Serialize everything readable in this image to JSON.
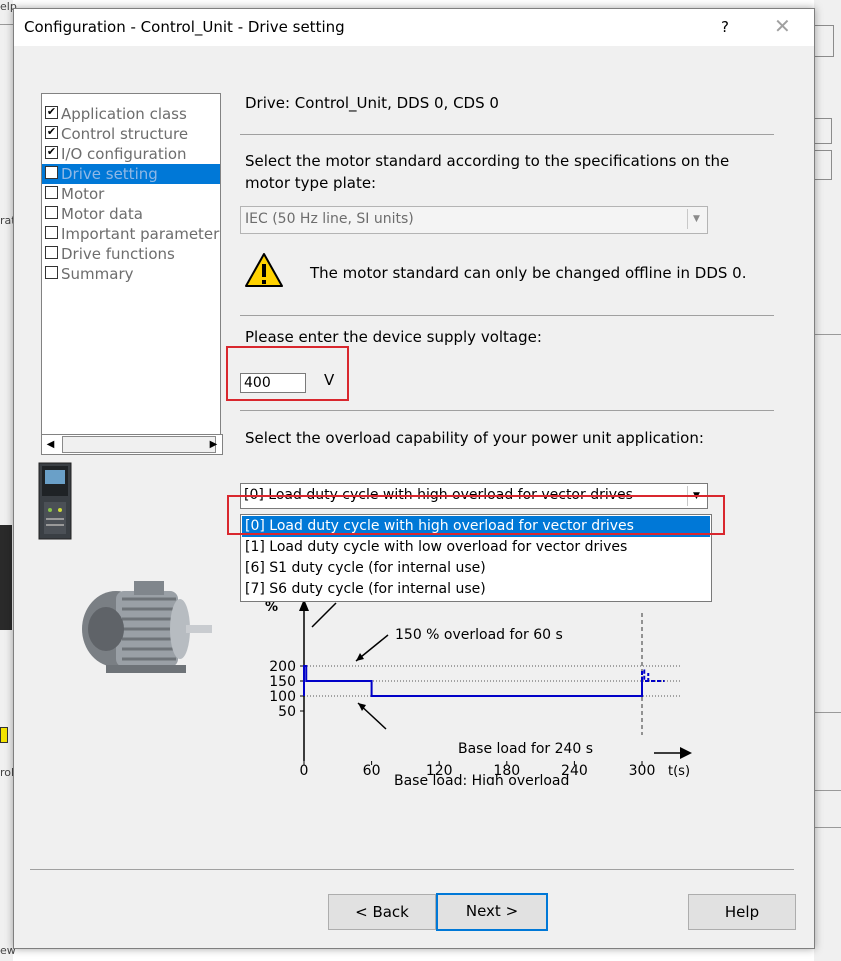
{
  "dialog": {
    "title": "Configuration - Control_Unit - Drive setting",
    "help_glyph": "?",
    "close_glyph": "✕"
  },
  "background": {
    "left_fragments": [
      "elp",
      "rat",
      "rol",
      "ew"
    ]
  },
  "nav": {
    "items": [
      {
        "label": "Application class",
        "checked": true
      },
      {
        "label": "Control structure",
        "checked": true
      },
      {
        "label": "I/O configuration",
        "checked": true
      },
      {
        "label": "Drive setting",
        "checked": false,
        "active": true
      },
      {
        "label": "Motor",
        "checked": false
      },
      {
        "label": "Motor data",
        "checked": false
      },
      {
        "label": "Important parameters",
        "checked": false
      },
      {
        "label": "Drive functions",
        "checked": false
      },
      {
        "label": "Summary",
        "checked": false
      }
    ],
    "check_glyph": "✔",
    "scroll_left": "◀",
    "scroll_right": "▶"
  },
  "main": {
    "drive_info": "Drive: Control_Unit, DDS 0, CDS 0",
    "motor_standard_prompt_1": "Select the motor standard according to the specifications on the",
    "motor_standard_prompt_2": "motor type plate:",
    "motor_standard_value": "IEC (50 Hz line, SI units)",
    "dropdown_glyph": "▼",
    "warning_text": "The motor standard can only be changed offline in DDS 0.",
    "voltage_prompt": "Please enter the device supply voltage:",
    "voltage_value": "400",
    "voltage_unit": "V",
    "overload_prompt": "Select the overload capability of your power unit application:",
    "overload_value": "[0] Load duty cycle with high overload for vector drives",
    "overload_options": [
      "[0] Load duty cycle with high overload for vector drives",
      "[1] Load duty cycle with low overload for vector drives",
      "[6] S1 duty cycle (for internal use)",
      "[7] S6 duty cycle (for internal use)"
    ],
    "selected_option_index": 0
  },
  "chart_data": {
    "type": "line",
    "title": "",
    "ylabel": "%",
    "xlabel": "t(s)",
    "y_ticks": [
      200,
      150,
      100,
      50
    ],
    "x_ticks": [
      "0",
      "60",
      "120",
      "180",
      "240",
      "300"
    ],
    "annotation_overload": "150 % overload for 60 s",
    "annotation_base_load": "Base load for 240 s",
    "caption": "Base load: High overload",
    "series": [
      {
        "x": [
          0,
          0,
          2,
          2,
          60,
          60,
          300,
          300
        ],
        "y": [
          100,
          200,
          200,
          150,
          150,
          100,
          100,
          150
        ]
      }
    ],
    "dashed_tail": {
      "x": [
        300,
        300,
        302,
        302,
        320
      ],
      "y": [
        150,
        185,
        185,
        150,
        150
      ]
    },
    "color": "#0000c8"
  },
  "buttons": {
    "back": "< Back",
    "next": "Next >",
    "help": "Help"
  }
}
